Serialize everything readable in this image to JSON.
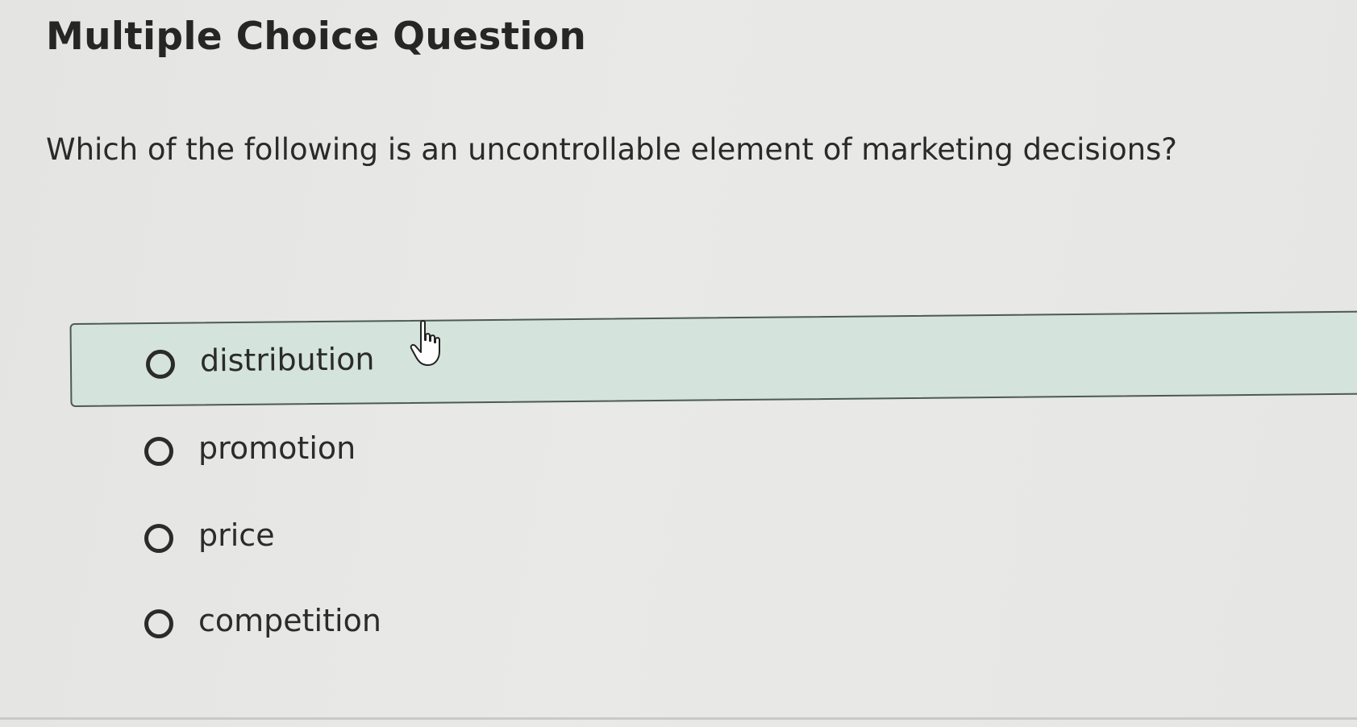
{
  "header": {
    "title": "Multiple Choice Question"
  },
  "question": {
    "text": "Which of the following is an uncontrollable element of marketing decisions?"
  },
  "options": [
    {
      "label": "distribution",
      "hovered": true
    },
    {
      "label": "promotion",
      "hovered": false
    },
    {
      "label": "price",
      "hovered": false
    },
    {
      "label": "competition",
      "hovered": false
    }
  ],
  "colors": {
    "hover_background": "#d4e4dd",
    "hover_border": "#4c5a55",
    "text": "#2a2a2a"
  },
  "icons": {
    "radio": "radio-button-icon",
    "cursor": "hand-pointer-icon"
  }
}
